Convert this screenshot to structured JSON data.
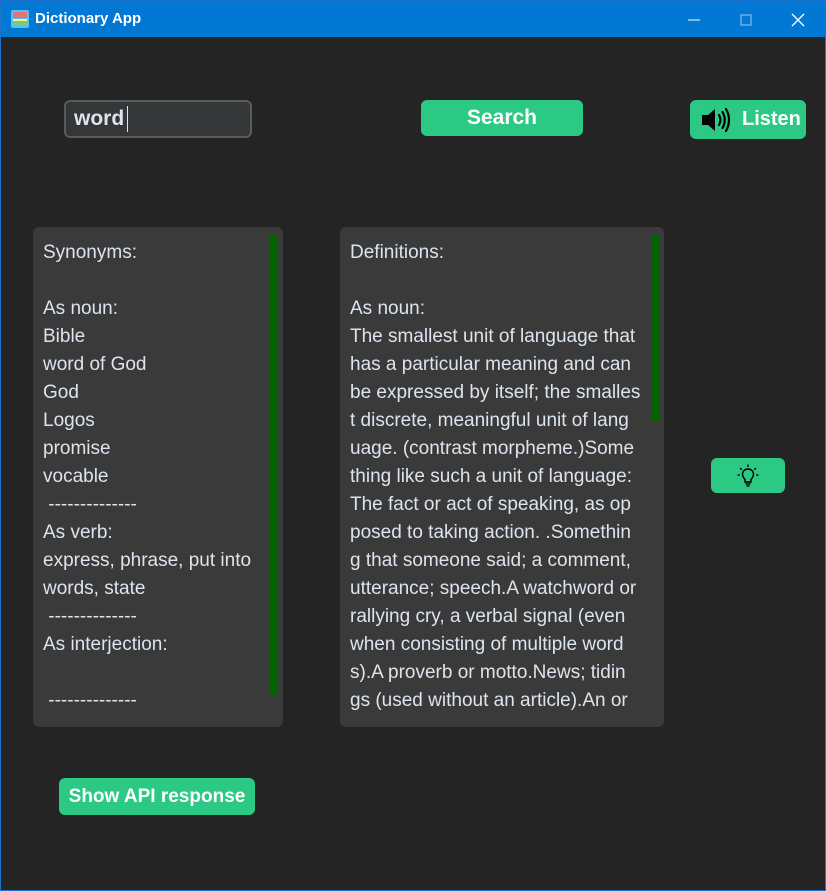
{
  "window": {
    "title": "Dictionary App",
    "icon": "dictionary-app-icon",
    "controls": [
      "minimize-icon",
      "maximize-icon",
      "close-icon"
    ]
  },
  "search": {
    "value": "word",
    "button_label": "Search"
  },
  "listen": {
    "icon": "speaker-icon",
    "label": "Listen"
  },
  "synonyms": {
    "lines": [
      "Synonyms:",
      "",
      "As noun:",
      "Bible",
      "word of God",
      "God",
      "Logos",
      "promise",
      "vocable",
      " --------------",
      "As verb:",
      "express, phrase, put into",
      "words, state",
      " --------------",
      "As interjection:",
      "",
      " --------------"
    ]
  },
  "definitions": {
    "lines": [
      "Definitions:",
      "",
      "As noun:",
      "The smallest unit of language that",
      "has a particular meaning and can",
      "be expressed by itself; the smalles",
      "t discrete, meaningful unit of lang",
      "uage. (contrast morpheme.)Some",
      "thing like such a unit of language:",
      "The fact or act of speaking, as op",
      "posed to taking action. .Somethin",
      "g that someone said; a comment,",
      "utterance; speech.A watchword or",
      "rallying cry, a verbal signal (even",
      "when consisting of multiple word",
      "s).A proverb or motto.News; tidin",
      "gs (used without an article).An or"
    ]
  },
  "hint_button": {
    "icon": "lightbulb-icon"
  },
  "api_button": {
    "label": "Show API response"
  },
  "colors": {
    "accent": "#2cc985",
    "background": "#242424",
    "panel": "#3a3a3a",
    "scrollbar": "#006400",
    "titlebar": "#0078d4"
  }
}
